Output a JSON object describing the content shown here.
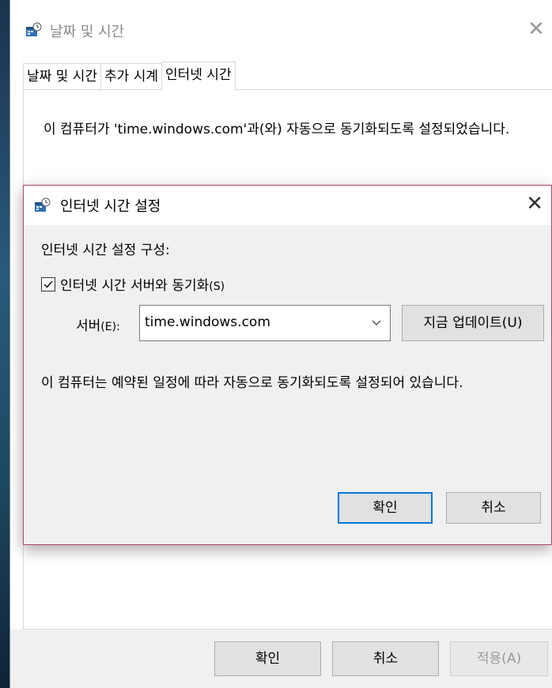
{
  "window": {
    "title": "날짜 및 시간",
    "close_glyph": "✕"
  },
  "tabs": [
    {
      "label": "날짜 및 시간"
    },
    {
      "label": "추가 시계"
    },
    {
      "label": "인터넷 시간"
    }
  ],
  "panel": {
    "text": "이 컴퓨터가 'time.windows.com'과(와) 자동으로 동기화되도록 설정되었습니다."
  },
  "footer": {
    "ok_label": "확인",
    "cancel_label": "취소",
    "apply_label": "적용(A)"
  },
  "dialog": {
    "title": "인터넷 시간 설정",
    "close_glyph": "✕",
    "config_label": "인터넷 시간 설정 구성:",
    "sync_checkbox_label": "인터넷 시간 서버와 동기화",
    "sync_checkbox_shortcut": "(S)",
    "sync_checked": true,
    "server_label": "서버",
    "server_shortcut": "(E):",
    "server_value": "time.windows.com",
    "update_label": "지금 업데이트",
    "update_shortcut": "(U)",
    "info_text": "이 컴퓨터는 예약된 일정에 따라 자동으로 동기화되도록 설정되어 있습니다.",
    "ok_label": "확인",
    "cancel_label": "취소"
  },
  "colors": {
    "accent": "#0078d7",
    "dialog_border": "#b7436b"
  }
}
